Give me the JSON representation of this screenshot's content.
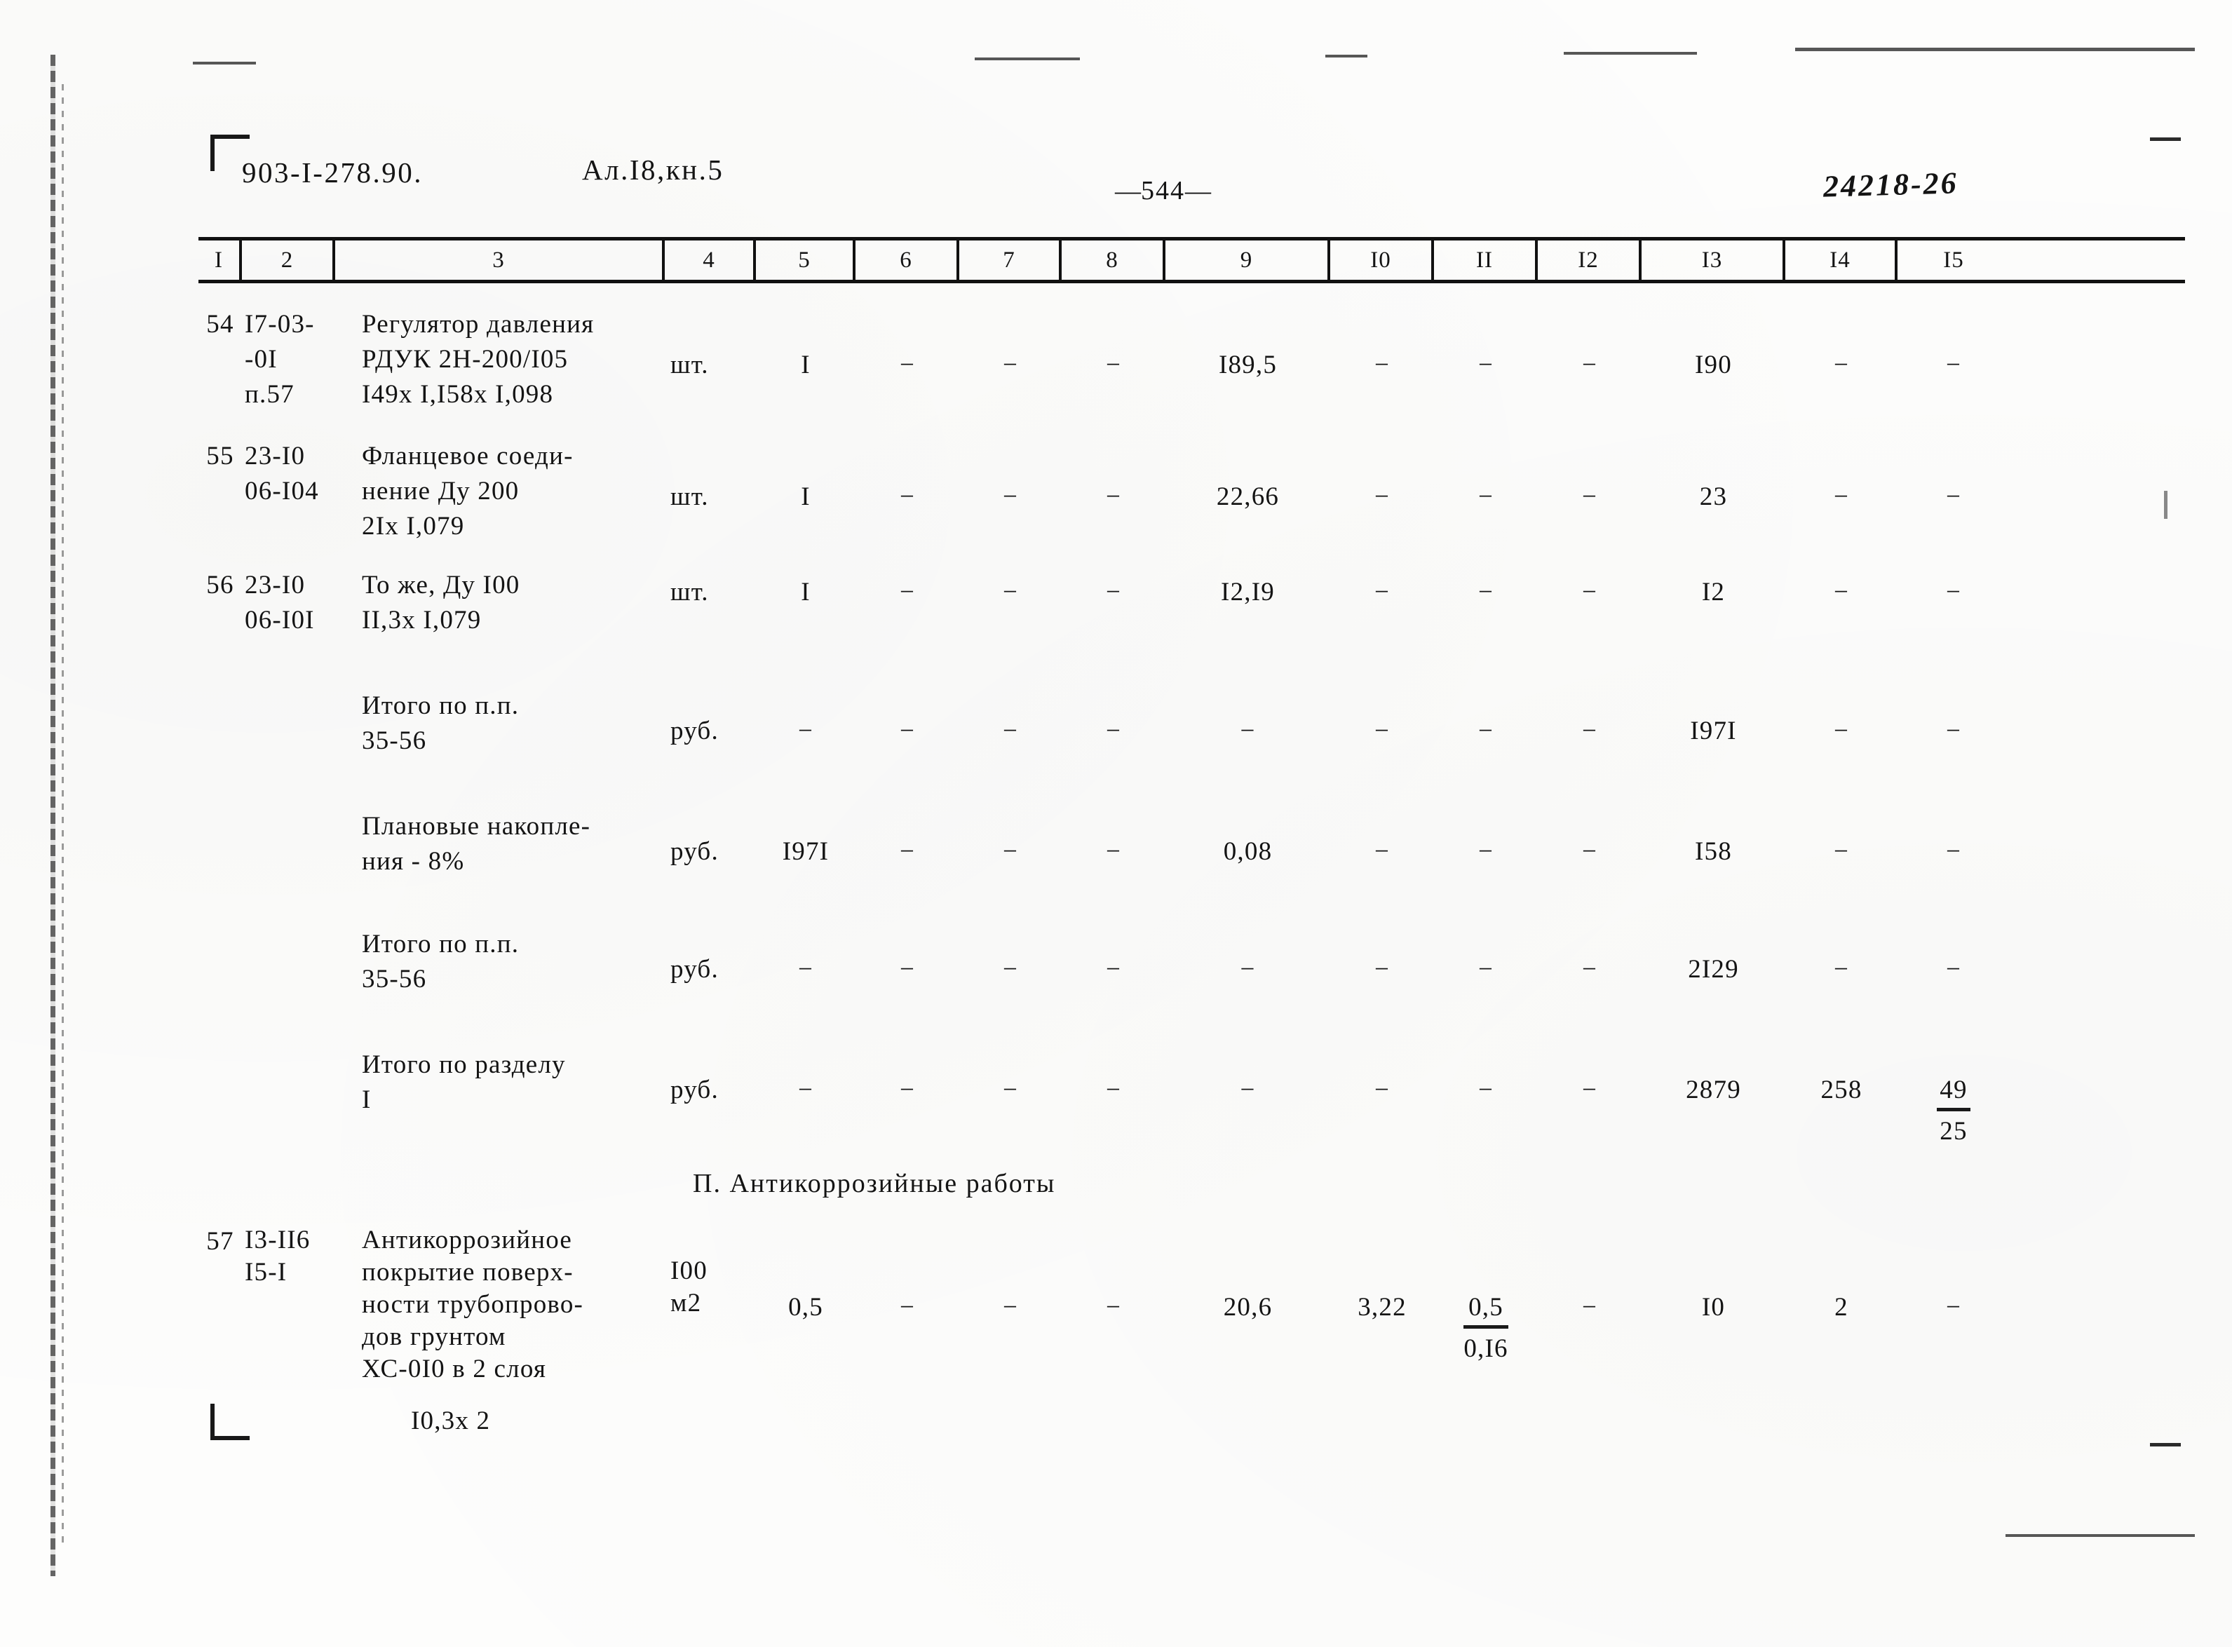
{
  "header": {
    "doc_code": "903-I-278.90.",
    "album": "Ал.I8,кн.5",
    "page_label": "544",
    "page_dash_left": "—",
    "page_dash_right": "—",
    "archive_stamp": "24218-26"
  },
  "table": {
    "column_headers": [
      "I",
      "2",
      "3",
      "4",
      "5",
      "6",
      "7",
      "8",
      "9",
      "I0",
      "II",
      "I2",
      "I3",
      "I4",
      "I5"
    ],
    "dash": "−",
    "rows": [
      {
        "no": "54",
        "code": "I7-03-\n-0I\nп.57",
        "desc": "Регулятор давления\nРДУК 2Н-200/I05\nI49х I,I58х I,098",
        "unit": "шт.",
        "c5": "I",
        "c6": "−",
        "c7": "−",
        "c8": "−",
        "c9": "I89,5",
        "c10": "−",
        "c11": "−",
        "c12": "−",
        "c13": "I90",
        "c14": "−",
        "c15": "−"
      },
      {
        "no": "55",
        "code": "23-I0\n06-I04",
        "desc": "Фланцевое соеди-\nнение Ду 200\n2Iх I,079",
        "unit": "шт.",
        "c5": "I",
        "c6": "−",
        "c7": "−",
        "c8": "−",
        "c9": "22,66",
        "c10": "−",
        "c11": "−",
        "c12": "−",
        "c13": "23",
        "c14": "−",
        "c15": "−"
      },
      {
        "no": "56",
        "code": "23-I0\n06-I0I",
        "desc": "То же, Ду I00\nII,3х I,079",
        "unit": "шт.",
        "c5": "I",
        "c6": "−",
        "c7": "−",
        "c8": "−",
        "c9": "I2,I9",
        "c10": "−",
        "c11": "−",
        "c12": "−",
        "c13": "I2",
        "c14": "−",
        "c15": "−"
      },
      {
        "no": "",
        "code": "",
        "desc": "Итого по п.п.\n        35-56",
        "unit": "руб.",
        "c5": "−",
        "c6": "−",
        "c7": "−",
        "c8": "−",
        "c9": "−",
        "c10": "−",
        "c11": "−",
        "c12": "−",
        "c13": "I97I",
        "c14": "−",
        "c15": "−"
      },
      {
        "no": "",
        "code": "",
        "desc": "Плановые накопле-\nния - 8%",
        "unit": "руб.",
        "c5": "I97I",
        "c6": "−",
        "c7": "−",
        "c8": "−",
        "c9": "0,08",
        "c10": "−",
        "c11": "−",
        "c12": "−",
        "c13": "I58",
        "c14": "−",
        "c15": "−"
      },
      {
        "no": "",
        "code": "",
        "desc": "Итого по п.п.\n        35-56",
        "unit": "руб.",
        "c5": "−",
        "c6": "−",
        "c7": "−",
        "c8": "−",
        "c9": "−",
        "c10": "−",
        "c11": "−",
        "c12": "−",
        "c13": "2I29",
        "c14": "−",
        "c15": "−"
      },
      {
        "no": "",
        "code": "",
        "desc": "Итого по разделу\n          I",
        "unit": "руб.",
        "c5": "−",
        "c6": "−",
        "c7": "−",
        "c8": "−",
        "c9": "−",
        "c10": "−",
        "c11": "−",
        "c12": "−",
        "c13": "2879",
        "c14": "258",
        "c15_frac_top": "49",
        "c15_frac_bottom": "25"
      }
    ],
    "section_heading": "П. Антикоррозийные работы",
    "row57": {
      "no": "57",
      "code": "I3-II6\nI5-I",
      "desc": "Антикоррозийное\nпокрытие поверх-\nности трубопрово-\nдов грунтом\nХС-0I0 в 2 слоя",
      "desc_tail": "I0,3х 2",
      "unit": "I00\nм2",
      "c5": "0,5",
      "c6": "−",
      "c7": "−",
      "c8": "−",
      "c9": "20,6",
      "c10": "3,22",
      "c11_frac_top": "0,5",
      "c11_frac_bottom": "0,I6",
      "c12": "−",
      "c13": "I0",
      "c14": "2",
      "c15": "−"
    }
  }
}
